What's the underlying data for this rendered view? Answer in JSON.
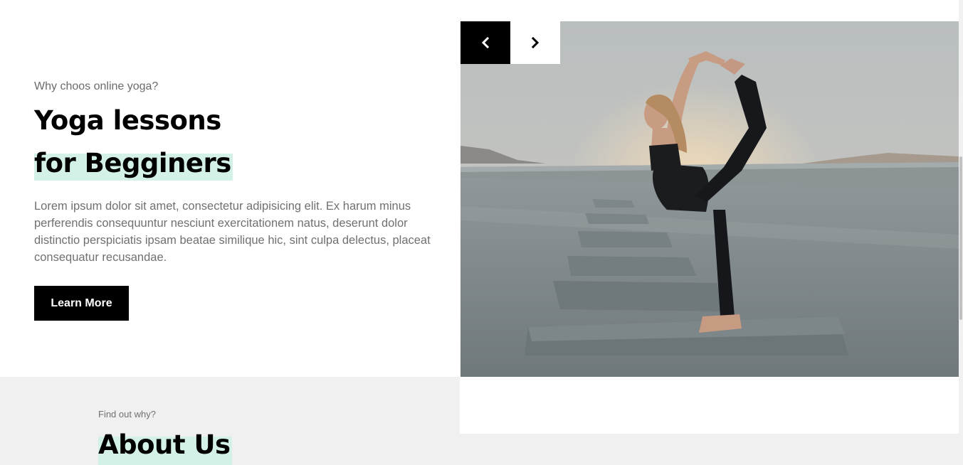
{
  "hero": {
    "eyebrow": "Why choos online yoga?",
    "title_line1": "Yoga lessons",
    "title_line2": "for Begginers",
    "description": "Lorem ipsum dolor sit amet, consectetur adipisicing elit. Ex harum minus perferendis consequuntur nesciunt exercitationem natus, deserunt dolor distinctio perspiciatis ipsam beatae similique hic, sint culpa delectus, placeat consequatur recusandae.",
    "button_label": "Learn More"
  },
  "slider": {
    "prev_icon": "chevron-left-icon",
    "next_icon": "chevron-right-icon",
    "image_subject": "yoga-pose-photo"
  },
  "about": {
    "eyebrow": "Find out why?",
    "title": "About Us"
  },
  "colors": {
    "highlight": "#d3f1e7",
    "button_bg": "#000000",
    "section_bg": "#f0f0f0"
  }
}
